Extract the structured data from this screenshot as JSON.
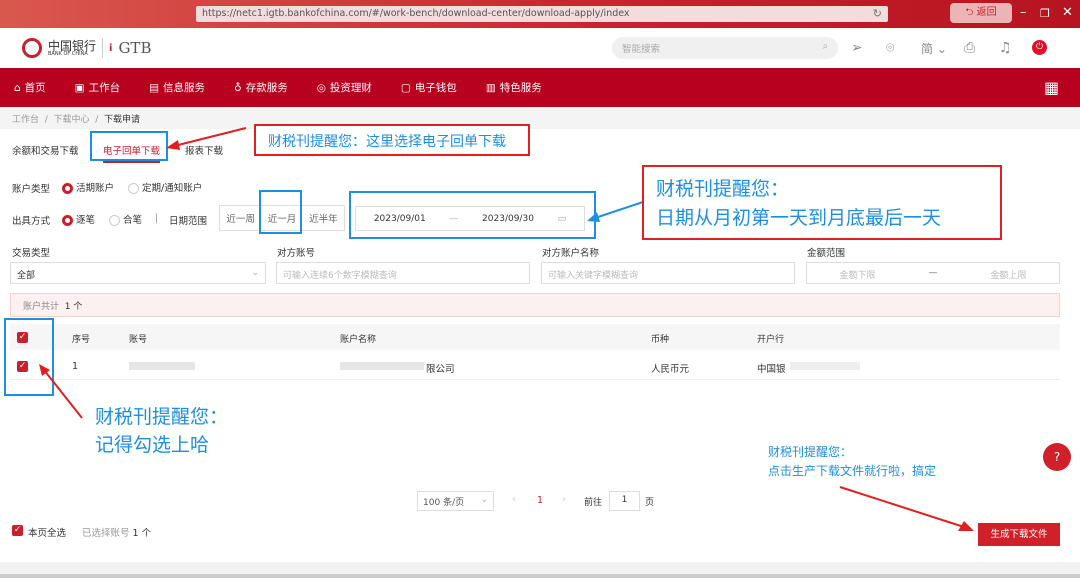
{
  "browser": {
    "url": "https://netc1.igtb.bankofchina.com/#/work-bench/download-center/download-apply/index",
    "back_label": "返回"
  },
  "header": {
    "logo_cn": "中国银行",
    "logo_en": "BANK OF CHINA",
    "product": "GTB",
    "search_placeholder": "智能搜索",
    "lang": "简"
  },
  "nav": [
    "首页",
    "工作台",
    "信息服务",
    "存款服务",
    "投资理财",
    "电子钱包",
    "特色服务"
  ],
  "breadcrumb": [
    "工作台",
    "下载中心",
    "下载申请"
  ],
  "tabs": [
    "余额和交易下载",
    "电子回单下载",
    "报表下载"
  ],
  "form": {
    "account_type_label": "账户类型",
    "account_types": [
      "活期账户",
      "定期/通知账户"
    ],
    "issue_label": "出具方式",
    "issue_options": [
      "逐笔",
      "合笔"
    ],
    "date_range_label": "日期范围",
    "quick_ranges": [
      "近一周",
      "近一月",
      "近半年"
    ],
    "date_start": "2023/09/01",
    "date_end": "2023/09/30",
    "txn_type_label": "交易类型",
    "txn_type_value": "全部",
    "counter_acct_label": "对方账号",
    "counter_acct_placeholder": "可输入连续6个数字模糊查询",
    "counter_name_label": "对方账户名称",
    "counter_name_placeholder": "可输入关键字模糊查询",
    "amount_label": "金额范围",
    "amount_min": "金额下限",
    "amount_max": "金额上限"
  },
  "summary": {
    "label": "账户共计",
    "count": "1 个"
  },
  "table": {
    "headers": [
      "序号",
      "账号",
      "账户名称",
      "币种",
      "开户行"
    ],
    "rows": [
      {
        "no": "1",
        "account": "",
        "name": "限公司",
        "currency": "人民币元",
        "bank": "中国银"
      }
    ]
  },
  "pagination": {
    "page_size": "100 条/页",
    "current": "1",
    "goto_label": "前往",
    "goto_value": "1",
    "page_suffix": "页"
  },
  "footer": {
    "select_all": "本页全选",
    "selected_label": "已选择账号",
    "selected_count": "1 个",
    "generate_button": "生成下载文件"
  },
  "annotations": {
    "a1": "财税刊提醒您：这里选择电子回单下载",
    "a2_l1": "财税刊提醒您：",
    "a2_l2": "日期从月初第一天到月底最后一天",
    "a3_l1": "财税刊提醒您：",
    "a3_l2": "记得勾选上哈",
    "a4_l1": "财税刊提醒您：",
    "a4_l2": "点击生产下载文件就行啦，搞定"
  },
  "help": "?"
}
